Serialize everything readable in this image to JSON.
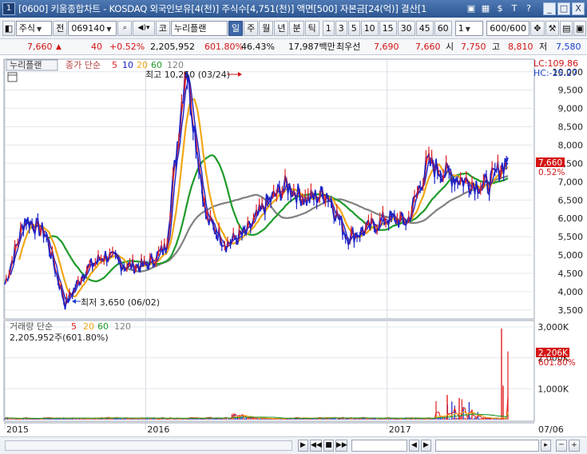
{
  "window": {
    "number": "1",
    "title": "[0600] 키움종합차트 - KOSDAQ 외국인보유[4(천)] 주식수[4,751(천)] 액면[500] 자본금[24(억)] 결산[1",
    "icons": [
      "link-icon",
      "grid-icon",
      "dollar-icon",
      "font-icon",
      "help-icon"
    ],
    "icon_glyphs": [
      "▣",
      "▦",
      "$",
      "T",
      "?"
    ],
    "controls": [
      "_",
      "□",
      "X"
    ]
  },
  "toolbar": {
    "type_label": "주식",
    "prev_label": "전",
    "code_value": "069140",
    "search_glyph": "🔍",
    "sound_glyph": "◀",
    "market_label": "코",
    "stock_name": "누리플랜",
    "periods": [
      "일",
      "주",
      "월",
      "년",
      "분",
      "틱"
    ],
    "numbers": [
      "1",
      "3",
      "5",
      "10",
      "15",
      "30",
      "45",
      "60"
    ],
    "interval_value": "1",
    "count_value": "600",
    "count_total": "/600"
  },
  "quote": {
    "price": "7,660",
    "change": "40",
    "change_pct": "+0.52%",
    "volume": "2,205,952",
    "volume_pct": "601.80%",
    "turnover_pct": "46.43%",
    "amount": "17,987백만",
    "ask_label": "최우선",
    "ask": "7,690",
    "bid": "7,660",
    "open_label": "시",
    "open": "7,750",
    "high_label": "고",
    "high": "8,810",
    "low_label": "저",
    "low": "7,580"
  },
  "chart": {
    "price_legend": {
      "name": "누리플랜",
      "label": "종가 단순",
      "periods": [
        "5",
        "10",
        "20",
        "60",
        "120"
      ]
    },
    "volume_legend": {
      "label": "거래량 단순",
      "periods": [
        "5",
        "20",
        "60",
        "120"
      ],
      "current": "2,205,952주(601.80%)"
    },
    "lc_label": "LC:109.86",
    "hc_label": "HC:-25.27",
    "high_annotation": "최고 10,250 (03/24)",
    "low_annotation": "최저 3,650 (06/02)",
    "price_tag": "7,660",
    "pct_tag": "0.52%",
    "vol_tag": "2,206K",
    "vol_pct_tag": "601.80%",
    "price_ticks": [
      "10,000",
      "9,500",
      "9,000",
      "8,500",
      "8,000",
      "7,500",
      "7,000",
      "6,500",
      "6,000",
      "5,500",
      "5,000",
      "4,500",
      "4,000",
      "3,500"
    ],
    "volume_ticks": [
      "3,000K",
      "2,000K",
      "1,000K"
    ],
    "x_labels": [
      "2015",
      "2016",
      "2017"
    ],
    "x_right_label": "07/06",
    "colors": {
      "price": "#1a22c8",
      "ma5": "#e02020",
      "ma10": "#1a22c8",
      "ma20": "#f0a818",
      "ma60": "#1f9a2a",
      "ma120": "#808080",
      "tag": "#d41414"
    }
  },
  "chart_data": {
    "type": "line",
    "title": "누리플랜",
    "x": [
      "2015",
      "2015-03",
      "2015-05",
      "2015-06-02",
      "2015-07",
      "2015-09",
      "2015-11",
      "2016",
      "2016-02",
      "2016-03-24",
      "2016-04",
      "2016-05",
      "2016-06",
      "2016-07",
      "2016-08",
      "2016-09",
      "2016-10",
      "2016-11",
      "2016-12",
      "2017",
      "2017-02",
      "2017-03",
      "2017-04",
      "2017-05",
      "2017-06",
      "2017-07-06"
    ],
    "series": [
      {
        "name": "종가",
        "values": [
          4200,
          6000,
          5600,
          3650,
          4600,
          5000,
          4700,
          4700,
          5200,
          10250,
          6000,
          5300,
          5600,
          6400,
          6900,
          6500,
          6700,
          5500,
          5700,
          6000,
          5900,
          7500,
          7200,
          7000,
          6900,
          7660
        ]
      }
    ],
    "ylim": [
      3300,
      10300
    ],
    "volume_ylim": [
      0,
      3000000
    ],
    "last_volume": 2205952
  },
  "bottom": {
    "nav_buttons": [
      "▶",
      "◀◀",
      "■",
      "▶▶",
      "◀",
      "▶",
      "─",
      "+"
    ]
  }
}
